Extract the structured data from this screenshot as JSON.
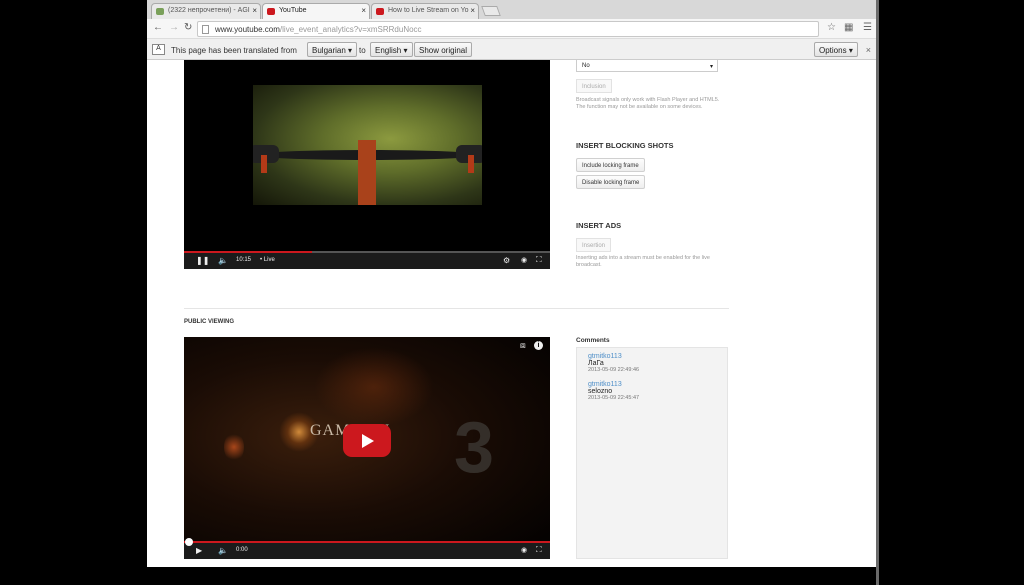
{
  "tabs": [
    {
      "title": "(2322 непрочетени) - AGI"
    },
    {
      "title": "YouTube"
    },
    {
      "title": "How to Live Stream on Yo"
    }
  ],
  "address": {
    "host": "www.youtube.com",
    "rest": "/live_event_analytics?v=xmSRRduNocc"
  },
  "translate": {
    "prefix": "This page has been translated from",
    "from_lang": "Bulgarian",
    "to_word": "to",
    "to_lang": "English",
    "show_original": "Show original",
    "options": "Options"
  },
  "player1": {
    "time": "10:15",
    "live": "• Live",
    "progress": 0.35
  },
  "side": {
    "select_value": "No",
    "inclusion_btn": "Inclusion",
    "inclusion_note": "Broadcast signals only work with Flash Player and HTML5. The function may not be available on some devices.",
    "blocking_title": "INSERT BLOCKING SHOTS",
    "include_btn": "Include locking frame",
    "disable_btn": "Disable locking frame",
    "ads_title": "INSERT ADS",
    "insertion_btn": "Insertion",
    "ads_note": "Inserting ads into a stream must be enabled for the live broadcast."
  },
  "public_viewing": {
    "title": "PUBLIC VIEWING",
    "video_text": "GAMEOW",
    "big_number": "3",
    "time": "0:00",
    "progress": 0.0
  },
  "comments": {
    "heading": "Comments",
    "items": [
      {
        "user": "gtmitko113",
        "text": "ЛаГа",
        "date": "2013-05-09 22:49:46"
      },
      {
        "user": "gtmitko113",
        "text": "selozno",
        "date": "2013-05-09 22:45:47"
      }
    ]
  },
  "colors": {
    "youtube_red": "#cc181e",
    "link_blue": "#4f8fc8"
  }
}
